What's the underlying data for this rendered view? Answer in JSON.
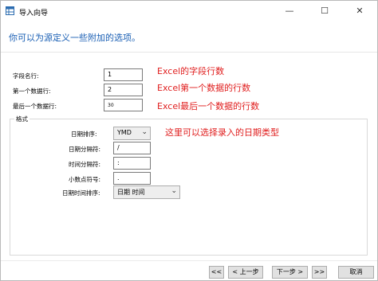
{
  "window": {
    "title": "导入向导",
    "minimize_glyph": "—",
    "maximize_glyph": "☐",
    "close_glyph": "✕"
  },
  "heading": "你可以为源定义一些附加的选项。",
  "fields": {
    "field_name_row": {
      "label": "字段名行:",
      "value": "1"
    },
    "first_data_row": {
      "label": "第一个数据行:",
      "value": "2"
    },
    "last_data_row": {
      "label": "最后一个数据行:",
      "value": "30"
    }
  },
  "annotations": {
    "field_name_row": "Excel的字段行数",
    "first_data_row": "Excel第一个数据的行数",
    "last_data_row": "Excel最后一个数据的行数",
    "date_order": "这里可以选择录入的日期类型"
  },
  "format_group": {
    "legend": "格式",
    "date_order": {
      "label": "日期排序:",
      "value": "YMD"
    },
    "date_separator": {
      "label": "日期分隔符:",
      "value": "/"
    },
    "time_separator": {
      "label": "时间分隔符:",
      "value": ":"
    },
    "decimal_symbol": {
      "label": "小数点符号:",
      "value": "."
    },
    "datetime_order": {
      "label": "日期时间排序:",
      "value": "日期 时间"
    }
  },
  "buttons": {
    "first": "<<",
    "previous": "< 上一步",
    "next": "下一步 >",
    "last": ">>",
    "cancel": "取消"
  },
  "colors": {
    "heading": "#1a5fb4",
    "annotation": "#e01e1e"
  }
}
